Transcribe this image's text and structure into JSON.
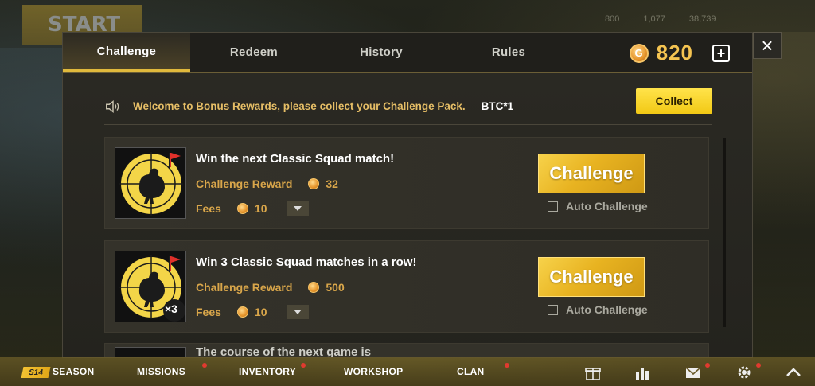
{
  "modal": {
    "tabs": [
      {
        "label": "Challenge",
        "active": true
      },
      {
        "label": "Redeem",
        "active": false
      },
      {
        "label": "History",
        "active": false
      },
      {
        "label": "Rules",
        "active": false
      }
    ],
    "coin_symbol": "G",
    "coin_balance": "820",
    "plus_label": "+",
    "close_label": "×"
  },
  "announcement": {
    "icon": "speaker-icon",
    "text": "Welcome to Bonus Rewards, please collect your Challenge Pack.",
    "code": "BTC*1",
    "collect_label": "Collect"
  },
  "challenges": [
    {
      "title": "Win the next Classic Squad match!",
      "reward_label": "Challenge Reward",
      "reward_value": "32",
      "fees_label": "Fees",
      "fees_value": "10",
      "button_label": "Challenge",
      "auto_label": "Auto Challenge",
      "multiplier": ""
    },
    {
      "title": "Win 3 Classic Squad matches in a row!",
      "reward_label": "Challenge Reward",
      "reward_value": "500",
      "fees_label": "Fees",
      "fees_value": "10",
      "button_label": "Challenge",
      "auto_label": "Auto Challenge",
      "multiplier": "×3"
    }
  ],
  "partial_card": {
    "title": "The course of the next game is"
  },
  "bottom_nav": {
    "season_badge": "S14",
    "season": "SEASON",
    "missions": "MISSIONS",
    "inventory": "INVENTORY",
    "workshop": "WORKSHOP",
    "clan": "CLAN"
  },
  "background": {
    "start_label": "START",
    "stats": [
      "800",
      "1,077",
      "38,739"
    ]
  },
  "colors": {
    "accent_gold": "#f5c451",
    "button_yellow": "#f2c915",
    "label_orange": "#d9a64a"
  }
}
